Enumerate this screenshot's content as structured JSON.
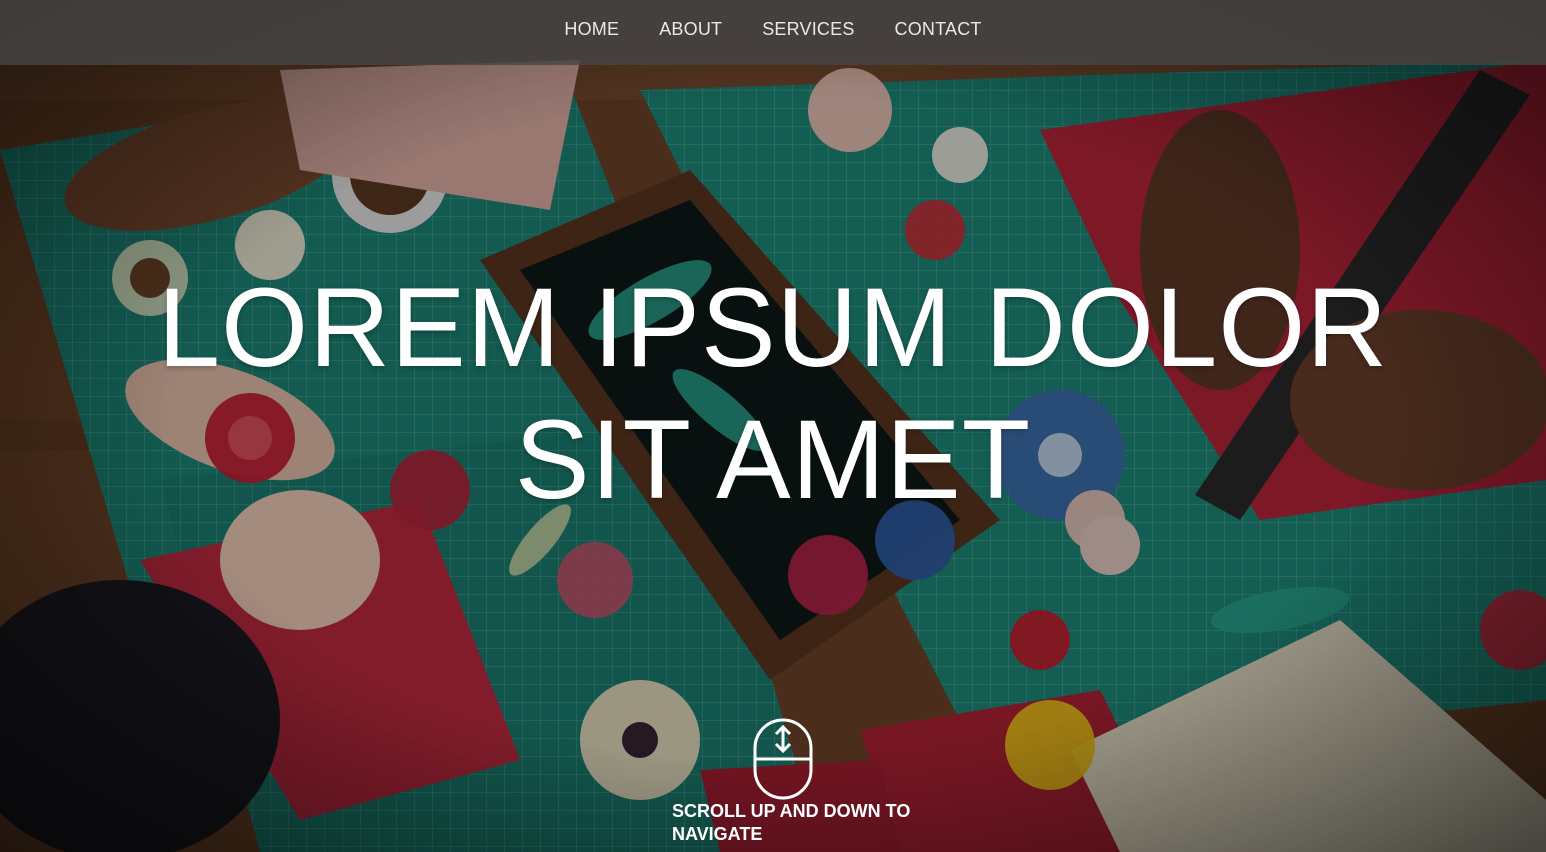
{
  "nav": {
    "items": [
      {
        "label": "HOME"
      },
      {
        "label": "ABOUT"
      },
      {
        "label": "SERVICES"
      },
      {
        "label": "CONTACT"
      }
    ]
  },
  "hero": {
    "headline_line1": "LOREM IPSUM DOLOR",
    "headline_line2": "SIT AMET",
    "scroll_hint": "SCROLL UP AND DOWN TO NAVIGATE",
    "background_icon": "paper-craft-photo",
    "scroll_icon": "mouse-scroll-icon"
  },
  "colors": {
    "navbar_bg": "#464646",
    "nav_text": "#e9e9e9",
    "headline": "#ffffff",
    "teal_mat": "#1f8f80",
    "red_paper": "#c8283f",
    "wood": "#7a4d2e"
  }
}
